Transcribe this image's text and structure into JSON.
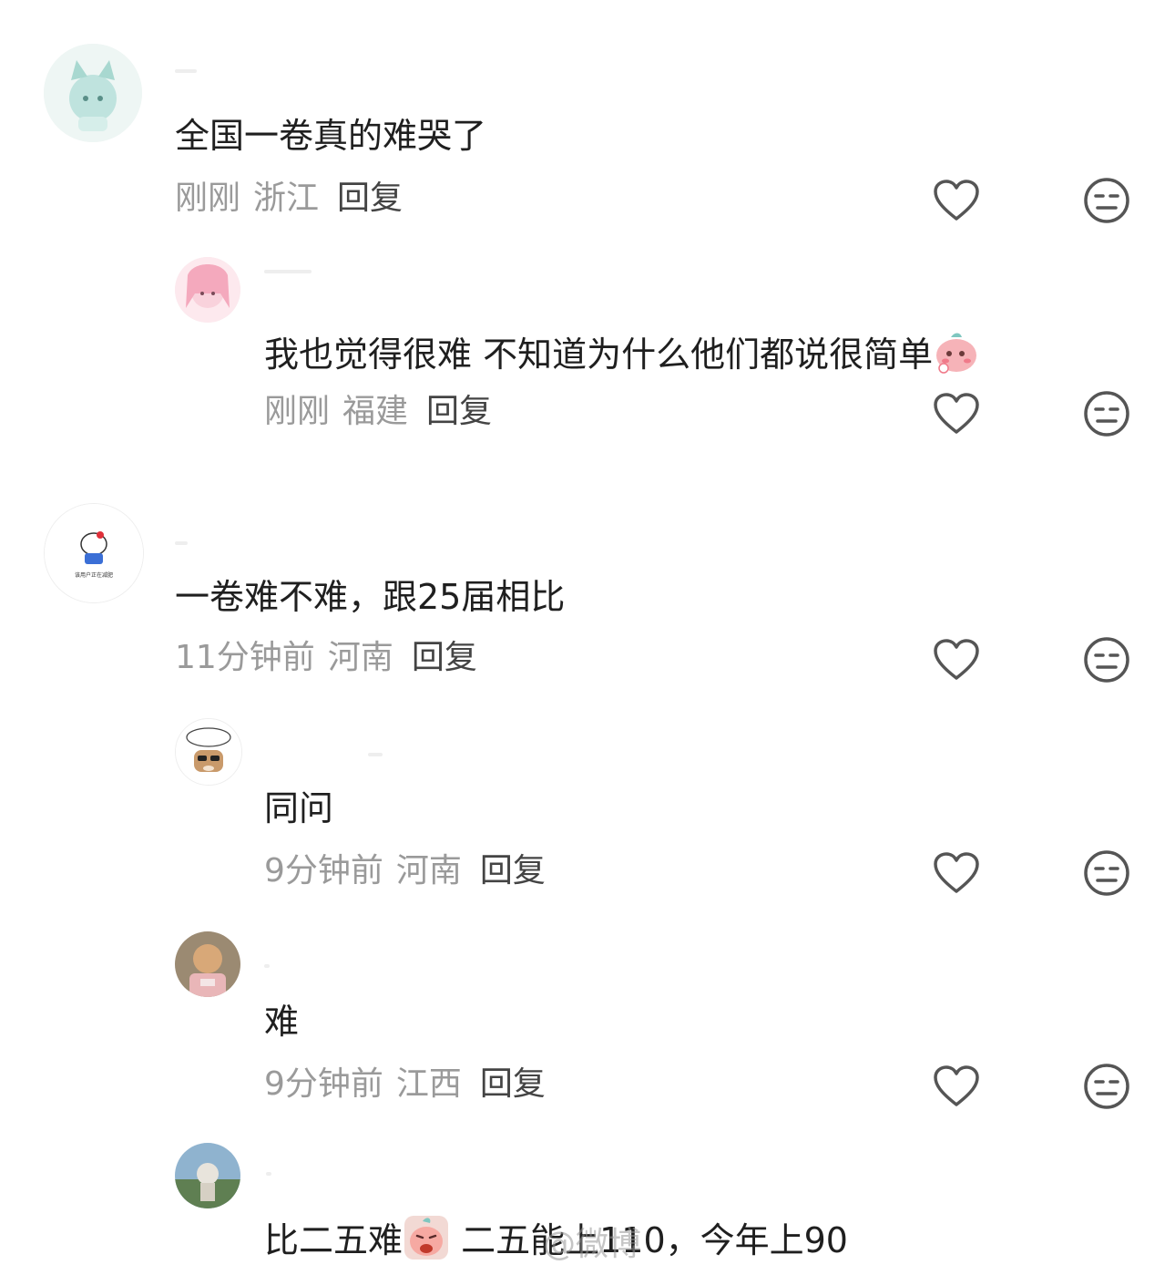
{
  "comments": [
    {
      "text": "全国一卷真的难哭了",
      "time": "刚刚",
      "location": "浙江",
      "reply_label": "回复"
    },
    {
      "text": "我也觉得很难 不知道为什么他们都说很简单",
      "time": "刚刚",
      "location": "福建",
      "reply_label": "回复"
    },
    {
      "text": "一卷难不难，跟25届相比",
      "time": "11分钟前",
      "location": "河南",
      "reply_label": "回复",
      "avatar_caption": "该用户正在减肥"
    },
    {
      "text": "同问",
      "time": "9分钟前",
      "location": "河南",
      "reply_label": "回复"
    },
    {
      "text": "难",
      "time": "9分钟前",
      "location": "江西",
      "reply_label": "回复"
    },
    {
      "text_before": "比二五难",
      "text_after": " 二五能上110，今年上90"
    }
  ],
  "watermark": "@微博",
  "icons": {
    "like": "heart-outline-icon",
    "dislike": "meh-face-icon"
  },
  "colors": {
    "text": "#1f1f1f",
    "meta": "#9a9a9a",
    "reply": "#444444",
    "icon": "#555555"
  }
}
